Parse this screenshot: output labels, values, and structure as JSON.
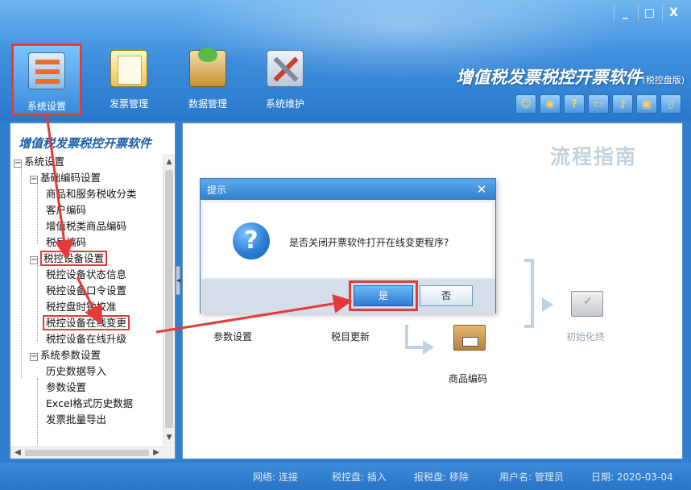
{
  "window": {
    "min_icon": "minimize-icon",
    "max_icon": "maximize-icon",
    "close_icon": "close-icon",
    "min_label": "_",
    "max_label": "□",
    "close_label": "X"
  },
  "toolbar": {
    "items": [
      {
        "label": "系统设置",
        "icon": "settings-icon"
      },
      {
        "label": "发票管理",
        "icon": "invoice-folder-icon"
      },
      {
        "label": "数据管理",
        "icon": "data-box-icon"
      },
      {
        "label": "系统维护",
        "icon": "tools-icon"
      }
    ]
  },
  "app": {
    "title": "增值税发票税控开票软件",
    "edition": "(税控盘版)"
  },
  "quick_tools": [
    "user-icon",
    "globe-icon",
    "help-icon",
    "window-icon",
    "key-icon",
    "card-icon",
    "mobile-icon"
  ],
  "tree": {
    "title": "增值税发票税控开票软件",
    "nodes": [
      {
        "label": "系统设置",
        "level": 0,
        "expander": "⊟"
      },
      {
        "label": "基础编码设置",
        "level": 1,
        "expander": "⊟"
      },
      {
        "label": "商品和服务税收分类",
        "level": 2
      },
      {
        "label": "客户编码",
        "level": 2
      },
      {
        "label": "增值税类商品编码",
        "level": 2
      },
      {
        "label": "税目编码",
        "level": 2
      },
      {
        "label": "税控设备设置",
        "level": 1,
        "expander": "⊟"
      },
      {
        "label": "税控设备状态信息",
        "level": 2
      },
      {
        "label": "税控设备口令设置",
        "level": 2
      },
      {
        "label": "税控盘时钟校准",
        "level": 2
      },
      {
        "label": "税控设备在线变更",
        "level": 2
      },
      {
        "label": "税控设备在线升级",
        "level": 2
      },
      {
        "label": "系统参数设置",
        "level": 1,
        "expander": "⊟"
      },
      {
        "label": "历史数据导入",
        "level": 2
      },
      {
        "label": "参数设置",
        "level": 2
      },
      {
        "label": "Excel格式历史数据",
        "level": 2
      },
      {
        "label": "发票批量导出",
        "level": 2
      }
    ]
  },
  "guide": {
    "title": "流程指南",
    "steps": [
      "参数设置",
      "税目更新",
      "商品编码",
      "初始化终"
    ]
  },
  "dialog": {
    "title": "提示",
    "close_label": "✕",
    "message": "是否关闭开票软件打开在线变更程序?",
    "icon_glyph": "?",
    "yes_label": "是",
    "no_label": "否"
  },
  "status": {
    "network": "网络: 连接",
    "device": "税控盘: 插入",
    "report": "报税盘: 移除",
    "user": "用户名: 管理员",
    "date": "日期: 2020-03-04"
  },
  "colors": {
    "accent": "#2f7fce",
    "highlight": "#e33b3b"
  }
}
